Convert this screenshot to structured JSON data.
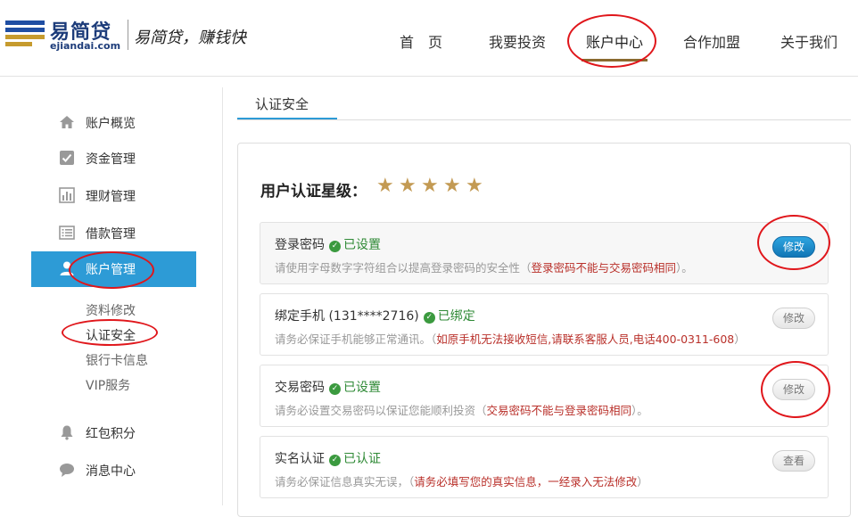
{
  "logo": {
    "name": "易简贷",
    "domain": "ejiandai.com",
    "slogan": "易简贷，赚钱快"
  },
  "nav": [
    "首　页",
    "我要投资",
    "账户中心",
    "合作加盟",
    "关于我们"
  ],
  "sidebar": {
    "items": [
      {
        "label": "账户概览",
        "icon": "home-icon"
      },
      {
        "label": "资金管理",
        "icon": "checkbox-icon"
      },
      {
        "label": "理财管理",
        "icon": "bar-chart-icon"
      },
      {
        "label": "借款管理",
        "icon": "list-icon"
      },
      {
        "label": "账户管理",
        "icon": "user-icon"
      }
    ],
    "sub_items": [
      "资料修改",
      "认证安全",
      "银行卡信息",
      "VIP服务"
    ],
    "bottom_items": [
      {
        "label": "红包积分",
        "icon": "bell-icon"
      },
      {
        "label": "消息中心",
        "icon": "chat-icon"
      }
    ]
  },
  "tab": "认证安全",
  "rating": {
    "label": "用户认证星级：",
    "stars": 5
  },
  "rows": [
    {
      "title": "登录密码",
      "status": "已设置",
      "desc": "请使用字母数字字符组合以提高登录密码的安全性（",
      "warn": "登录密码不能与交易密码相同",
      "desc_end": "）。",
      "button": "修改"
    },
    {
      "title": "绑定手机 (131****2716)",
      "status": "已绑定",
      "desc": "请务必保证手机能够正常通讯。（",
      "warn": "如原手机无法接收短信,请联系客服人员,电话400-0311-608",
      "desc_end": "）",
      "button": "修改"
    },
    {
      "title": "交易密码",
      "status": "已设置",
      "desc": "请务必设置交易密码以保证您能顺利投资（",
      "warn": "交易密码不能与登录密码相同",
      "desc_end": "）。",
      "button": "修改"
    },
    {
      "title": "实名认证",
      "status": "已认证",
      "desc": "请务必保证信息真实无误，（",
      "warn": "请务必填写您的真实信息，一经录入无法修改",
      "desc_end": "）",
      "button": "查看"
    }
  ],
  "colors": {
    "accent": "#2d9bd6",
    "star": "#c39a53",
    "ok": "#2f8a36",
    "warn": "#b9302a",
    "annotation": "#e0161b"
  }
}
